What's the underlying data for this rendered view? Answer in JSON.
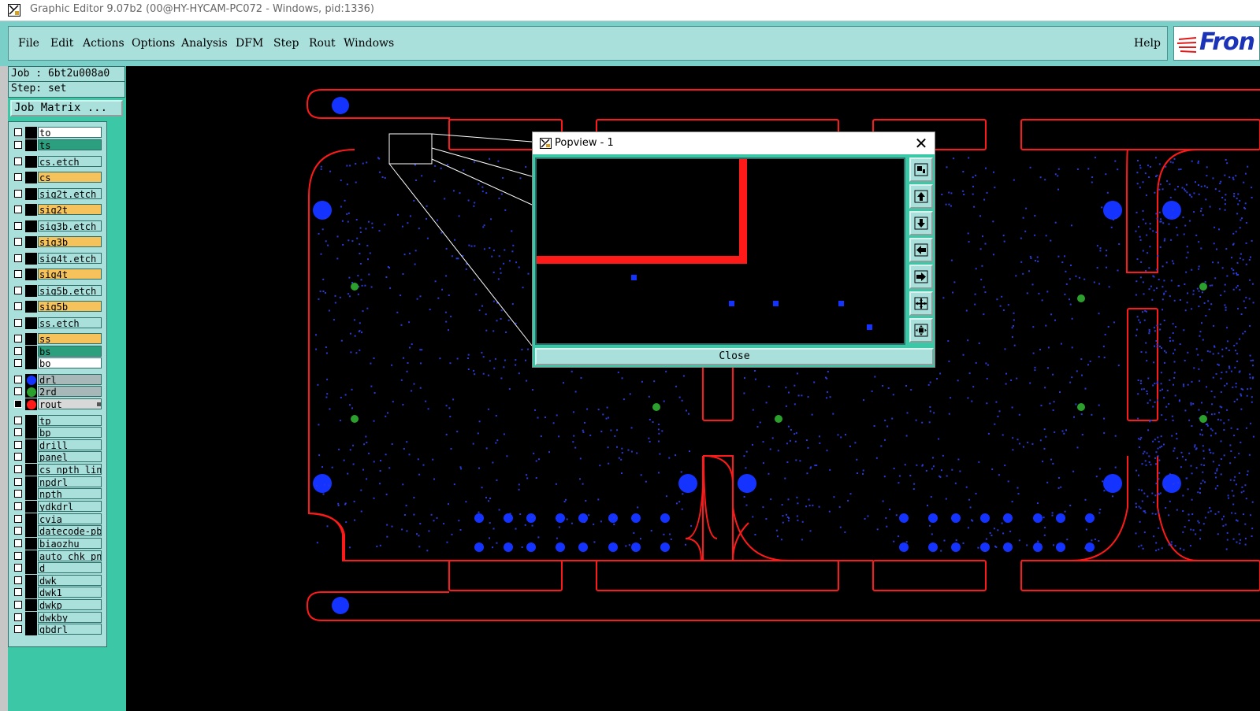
{
  "window": {
    "title": "Graphic Editor 9.07b2 (00@HY-HYCAM-PC072 - Windows, pid:1336)"
  },
  "menu": {
    "items": [
      "File",
      "Edit",
      "Actions",
      "Options",
      "Analysis",
      "DFM",
      "Step",
      "Rout",
      "Windows"
    ],
    "help": "Help",
    "logo_text": "Fron"
  },
  "job": {
    "job_line": "Job : 6bt2u008a0",
    "step_line": "Step: set",
    "matrix_button": "Job Matrix ..."
  },
  "layers": [
    {
      "name": "to",
      "color": "#ffffff"
    },
    {
      "name": "ts",
      "color": "#2b9f7e"
    },
    {
      "name": "cs.etch",
      "color": "#a9e0dc"
    },
    {
      "name": "cs",
      "color": "#f5c25c"
    },
    {
      "name": "sig2t.etch",
      "color": "#a9e0dc"
    },
    {
      "name": "sig2t",
      "color": "#f5c25c"
    },
    {
      "name": "sig3b.etch",
      "color": "#a9e0dc"
    },
    {
      "name": "sig3b",
      "color": "#f5c25c"
    },
    {
      "name": "sig4t.etch",
      "color": "#a9e0dc"
    },
    {
      "name": "sig4t",
      "color": "#f5c25c"
    },
    {
      "name": "sig5b.etch",
      "color": "#a9e0dc"
    },
    {
      "name": "sig5b",
      "color": "#f5c25c"
    },
    {
      "name": "ss.etch",
      "color": "#a9e0dc"
    },
    {
      "name": "ss",
      "color": "#f5c25c"
    },
    {
      "name": "bs",
      "color": "#2b9f7e"
    },
    {
      "name": "bo",
      "color": "#ffffff"
    },
    {
      "name": "drl",
      "color": "#a8b8b8",
      "dot": "#1533ff"
    },
    {
      "name": "2rd",
      "color": "#a8b8b8",
      "dot": "#2ca02c"
    },
    {
      "name": "rout",
      "color": "#d8d8d8",
      "dot": "#ff1a1a",
      "active": true
    },
    {
      "name": "tp",
      "color": "#a9e0dc"
    },
    {
      "name": "bp",
      "color": "#a9e0dc"
    },
    {
      "name": "drill",
      "color": "#a9e0dc"
    },
    {
      "name": "panel",
      "color": "#a9e0dc"
    },
    {
      "name": "cs_npth_line",
      "color": "#a9e0dc"
    },
    {
      "name": "npdrl",
      "color": "#a9e0dc"
    },
    {
      "name": "npth",
      "color": "#a9e0dc"
    },
    {
      "name": "ydkdrl",
      "color": "#a9e0dc"
    },
    {
      "name": "cvia",
      "color": "#a9e0dc"
    },
    {
      "name": "datecode-pbe",
      "color": "#a9e0dc"
    },
    {
      "name": "biaozhu",
      "color": "#a9e0dc"
    },
    {
      "name": "auto_chk_pnl",
      "color": "#a9e0dc"
    },
    {
      "name": "d",
      "color": "#a9e0dc"
    },
    {
      "name": "dwk",
      "color": "#a9e0dc"
    },
    {
      "name": "dwk1",
      "color": "#a9e0dc"
    },
    {
      "name": "dwkp",
      "color": "#a9e0dc"
    },
    {
      "name": "dwkby",
      "color": "#a9e0dc"
    },
    {
      "name": "gbdrl",
      "color": "#a9e0dc"
    }
  ],
  "popview": {
    "title": "Popview - 1",
    "close_button": "Close",
    "close_glyph": "✕"
  },
  "colors": {
    "rout": "#ff1a1a",
    "drl": "#1533ff",
    "second_drill": "#2ca02c",
    "panel_bg": "#3cc8a6",
    "button_bg": "#a9e0dc"
  }
}
